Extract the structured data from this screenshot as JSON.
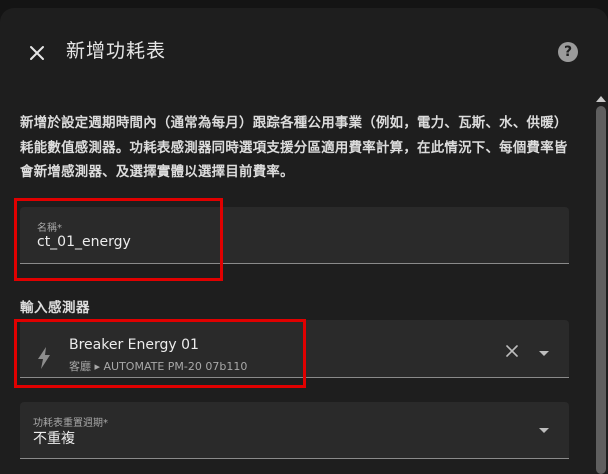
{
  "dialog": {
    "title": "新增功耗表",
    "description": "新增於設定週期時間內（通常為每月）跟踪各種公用事業（例如，電力、瓦斯、水、供暖）耗能數值感測器。功耗表感測器同時選項支援分區適用費率計算，在此情況下、每個費率皆會新增感測器、及選擇實體以選擇目前費率。"
  },
  "icons": {
    "close": "close-icon",
    "help": "help-icon",
    "bolt": "lightning-bolt-icon",
    "clear": "clear-icon",
    "dropdown": "chevron-down-icon"
  },
  "name_field": {
    "label": "名稱*",
    "value": "ct_01_energy"
  },
  "sensor_section": {
    "label": "輸入感測器"
  },
  "sensor_field": {
    "name": "Breaker Energy 01",
    "subtitle": "客廳 ▸ AUTOMATE PM-20 07b110"
  },
  "cycle_field": {
    "label": "功耗表重置週期*",
    "value": "不重複"
  },
  "colors": {
    "highlight": "#e00000",
    "dialog_bg": "#1e1e1e",
    "field_bg": "#2a2a2a"
  }
}
